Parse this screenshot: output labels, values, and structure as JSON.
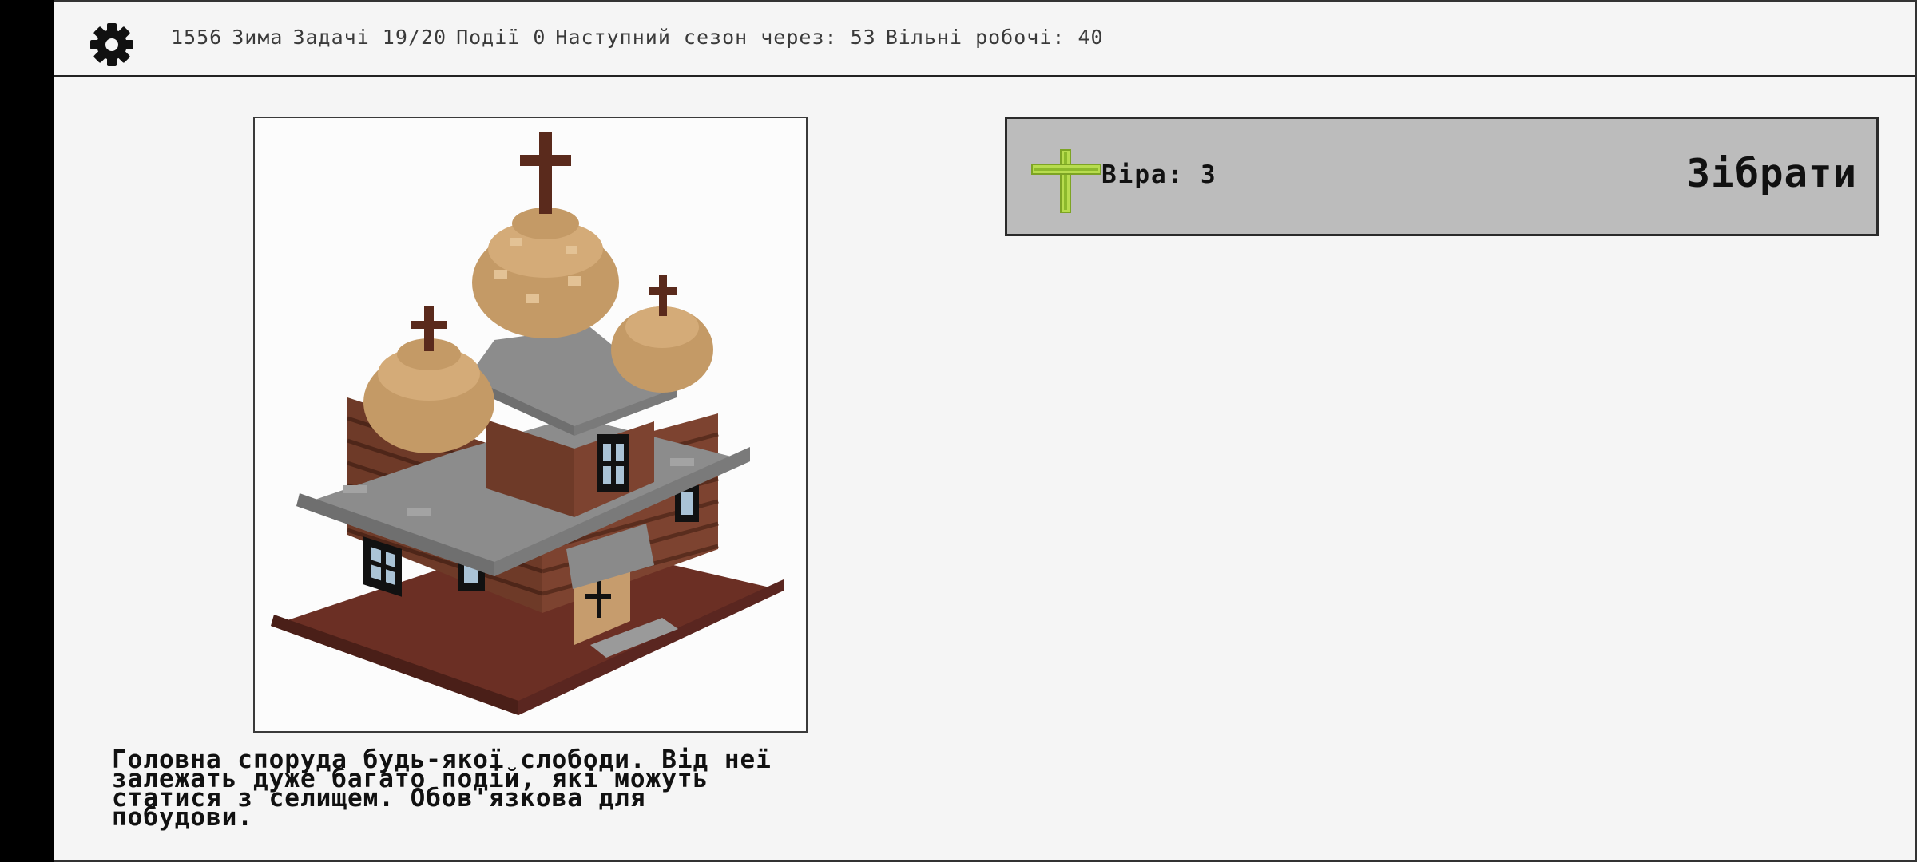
{
  "topbar": {
    "settings_icon": "gear-icon",
    "year": "1556",
    "season": "Зима",
    "tasks": "Задачі 19/20",
    "events": "Події 0",
    "next_season": "Наступний сезон через: 53",
    "free_workers": "Вільні робочі: 40"
  },
  "building": {
    "image_icon": "wooden-church-image",
    "description": "Головна споруда будь-якої слободи. Від неї\nзалежать дуже багато подій, які можуть\nстатися з селищем. Обов'язкова для\nпобудови."
  },
  "resource": {
    "icon": "cross-icon",
    "label": "Віра: 3",
    "collect_label": "Зібрати"
  },
  "colors": {
    "background": "#f5f5f5",
    "panel": "#bcbcbc",
    "cross_green": "#9bc53d",
    "text": "#111111"
  }
}
